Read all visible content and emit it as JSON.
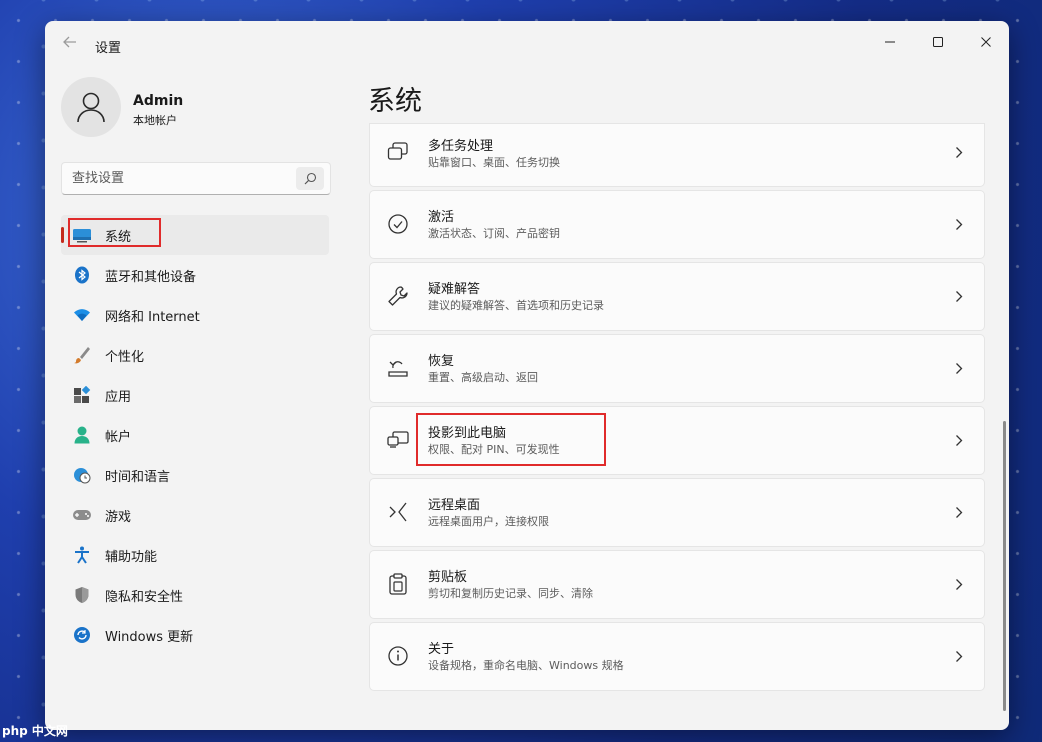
{
  "window": {
    "title": "设置"
  },
  "user": {
    "name": "Admin",
    "type": "本地帐户"
  },
  "search": {
    "placeholder": "查找设置"
  },
  "sidebar": {
    "items": [
      {
        "label": "系统",
        "icon": "system-display-icon",
        "active": true
      },
      {
        "label": "蓝牙和其他设备",
        "icon": "bluetooth-icon"
      },
      {
        "label": "网络和 Internet",
        "icon": "wifi-icon"
      },
      {
        "label": "个性化",
        "icon": "paintbrush-icon"
      },
      {
        "label": "应用",
        "icon": "apps-icon"
      },
      {
        "label": "帐户",
        "icon": "account-icon"
      },
      {
        "label": "时间和语言",
        "icon": "globe-clock-icon"
      },
      {
        "label": "游戏",
        "icon": "gamepad-icon"
      },
      {
        "label": "辅助功能",
        "icon": "accessibility-icon"
      },
      {
        "label": "隐私和安全性",
        "icon": "shield-icon"
      },
      {
        "label": "Windows 更新",
        "icon": "update-icon"
      }
    ]
  },
  "main": {
    "title": "系统",
    "cards": [
      {
        "title": "多任务处理",
        "desc": "贴靠窗口、桌面、任务切换",
        "icon": "multitasking-icon"
      },
      {
        "title": "激活",
        "desc": "激活状态、订阅、产品密钥",
        "icon": "activation-check-icon"
      },
      {
        "title": "疑难解答",
        "desc": "建议的疑难解答、首选项和历史记录",
        "icon": "wrench-icon"
      },
      {
        "title": "恢复",
        "desc": "重置、高级启动、返回",
        "icon": "recovery-icon"
      },
      {
        "title": "投影到此电脑",
        "desc": "权限、配对 PIN、可发现性",
        "icon": "project-to-pc-icon",
        "highlighted": true
      },
      {
        "title": "远程桌面",
        "desc": "远程桌面用户，连接权限",
        "icon": "remote-desktop-icon"
      },
      {
        "title": "剪贴板",
        "desc": "剪切和复制历史记录、同步、清除",
        "icon": "clipboard-icon"
      },
      {
        "title": "关于",
        "desc": "设备规格，重命名电脑、Windows 规格",
        "icon": "info-icon"
      }
    ]
  },
  "watermark": "php 中文网",
  "colors": {
    "highlight": "#e02b2b",
    "active_indicator": "#c42b1c",
    "window_bg": "#f3f3f3"
  }
}
